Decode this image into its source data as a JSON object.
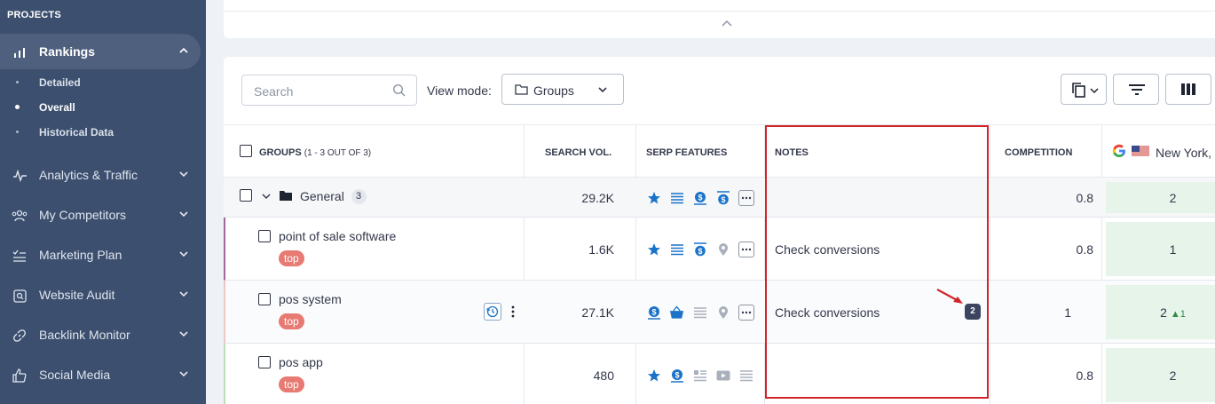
{
  "sidebar": {
    "heading": "PROJECTS",
    "active": "Rankings",
    "subitems": [
      {
        "label": "Detailed"
      },
      {
        "label": "Overall"
      },
      {
        "label": "Historical Data"
      }
    ],
    "items": [
      {
        "label": "Rankings",
        "icon": "bar-chart-icon"
      },
      {
        "label": "Analytics & Traffic",
        "icon": "pulse-icon"
      },
      {
        "label": "My Competitors",
        "icon": "users-icon"
      },
      {
        "label": "Marketing Plan",
        "icon": "checklist-icon"
      },
      {
        "label": "Website Audit",
        "icon": "audit-icon"
      },
      {
        "label": "Backlink Monitor",
        "icon": "link-icon"
      },
      {
        "label": "Social Media",
        "icon": "thumbs-up-icon"
      }
    ]
  },
  "toolbar": {
    "search_placeholder": "Search",
    "view_mode_label": "View mode:",
    "view_mode_value": "Groups"
  },
  "table": {
    "headers": {
      "groups": "GROUPS",
      "groups_count": "(1 - 3 OUT OF 3)",
      "search_vol": "SEARCH VOL.",
      "serp": "SERP FEATURES",
      "notes": "NOTES",
      "competition": "COMPETITION",
      "location": "New York,"
    },
    "group": {
      "name": "General",
      "count": "3",
      "search_vol": "29.2K",
      "competition": "0.8",
      "rank": "2"
    },
    "rows": [
      {
        "keyword": "point of sale software",
        "tag": "top",
        "search_vol": "1.6K",
        "note": "Check conversions",
        "competition": "0.8",
        "rank": "1",
        "rank_change": ""
      },
      {
        "keyword": "pos system",
        "tag": "top",
        "search_vol": "27.1K",
        "note": "Check conversions",
        "note_count": "2",
        "competition": "1",
        "rank": "2",
        "rank_change": "▲1"
      },
      {
        "keyword": "pos app",
        "tag": "top",
        "search_vol": "480",
        "note": "",
        "competition": "0.8",
        "rank": "2",
        "rank_change": ""
      }
    ]
  },
  "colors": {
    "sidebar_bg": "#3c4f6e",
    "highlight": "#d0262b",
    "tag_bg": "#e77a72",
    "rank_bg": "#e7f4ea",
    "serp_blue": "#1a73c8"
  }
}
